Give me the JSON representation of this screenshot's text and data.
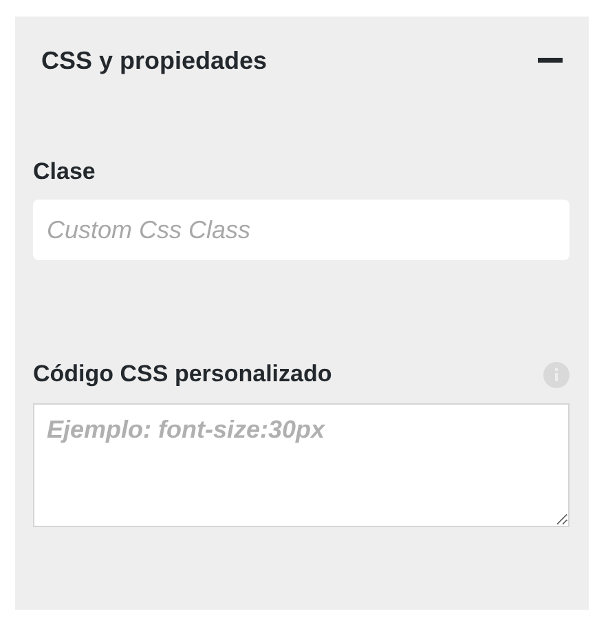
{
  "panel": {
    "title": "CSS y propiedades",
    "expanded": true
  },
  "fields": [
    {
      "kind": "input",
      "label": "Clase",
      "placeholder": "Custom Css Class"
    },
    {
      "kind": "textarea",
      "label": "Código CSS personalizado",
      "placeholder": "Ejemplo: font-size:30px"
    }
  ]
}
